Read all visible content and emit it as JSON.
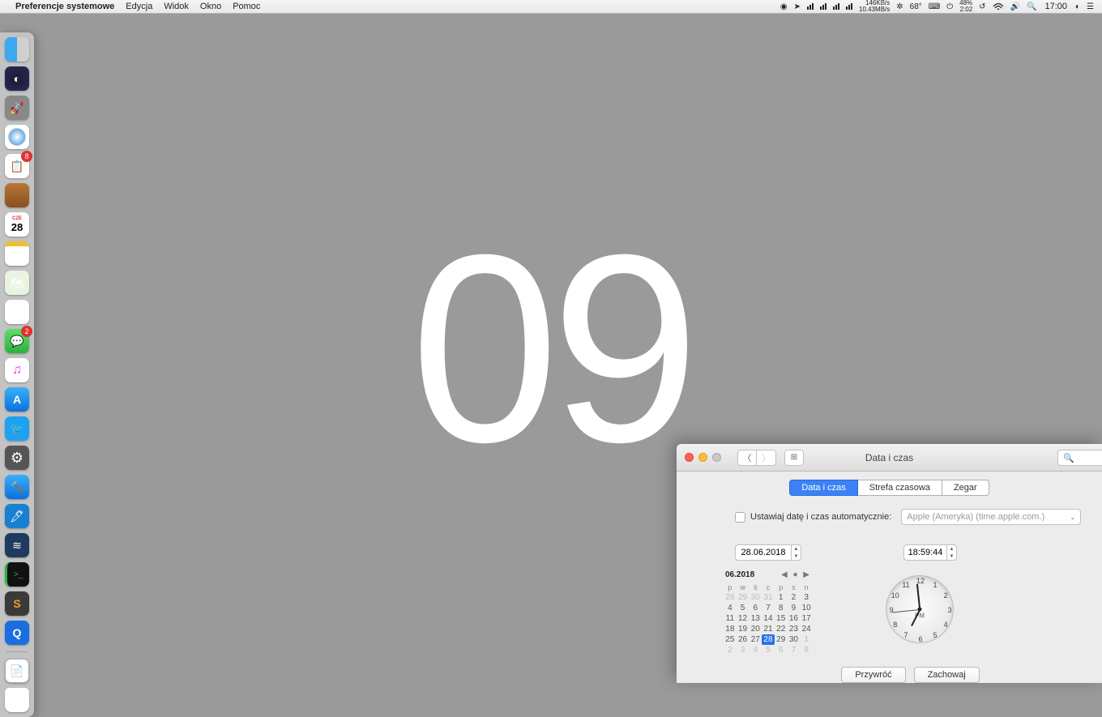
{
  "menubar": {
    "app": "Preferencje systemowe",
    "items": [
      "Edycja",
      "Widok",
      "Okno",
      "Pomoc"
    ],
    "status": {
      "net_up": "146KB/s",
      "net_down": "10.43MB/s",
      "temp": "68°",
      "battery_pct": "48%",
      "battery_time": "2:02",
      "clock": "17:00"
    }
  },
  "desktop": {
    "big": "09"
  },
  "dock": {
    "cal_day": "28",
    "badges": {
      "things": "8",
      "messages": "2"
    }
  },
  "window": {
    "title": "Data i czas",
    "tabs": [
      "Data i czas",
      "Strefa czasowa",
      "Zegar"
    ],
    "active_tab": 0,
    "auto_label": "Ustawiaj datę i czas automatycznie:",
    "auto_server": "Apple (Ameryka) (time.apple.com.)",
    "date_value": "28.06.2018",
    "time_value": "18:59:44",
    "cal_month": "06.2018",
    "weekdays": [
      "p",
      "w",
      "ś",
      "c",
      "p",
      "s",
      "n"
    ],
    "cal_prev": [
      "28",
      "29",
      "30",
      "31"
    ],
    "cal_days": [
      "1",
      "2",
      "3",
      "4",
      "5",
      "6",
      "7",
      "8",
      "9",
      "10",
      "11",
      "12",
      "13",
      "14",
      "15",
      "16",
      "17",
      "18",
      "19",
      "20",
      "21",
      "22",
      "23",
      "24",
      "25",
      "26",
      "27",
      "28",
      "29",
      "30"
    ],
    "cal_next": [
      "1",
      "2",
      "3",
      "4",
      "5",
      "6",
      "7",
      "8"
    ],
    "selected_day": "28",
    "clock_ampm": "PM",
    "btn_revert": "Przywróć",
    "btn_save": "Zachowaj"
  }
}
